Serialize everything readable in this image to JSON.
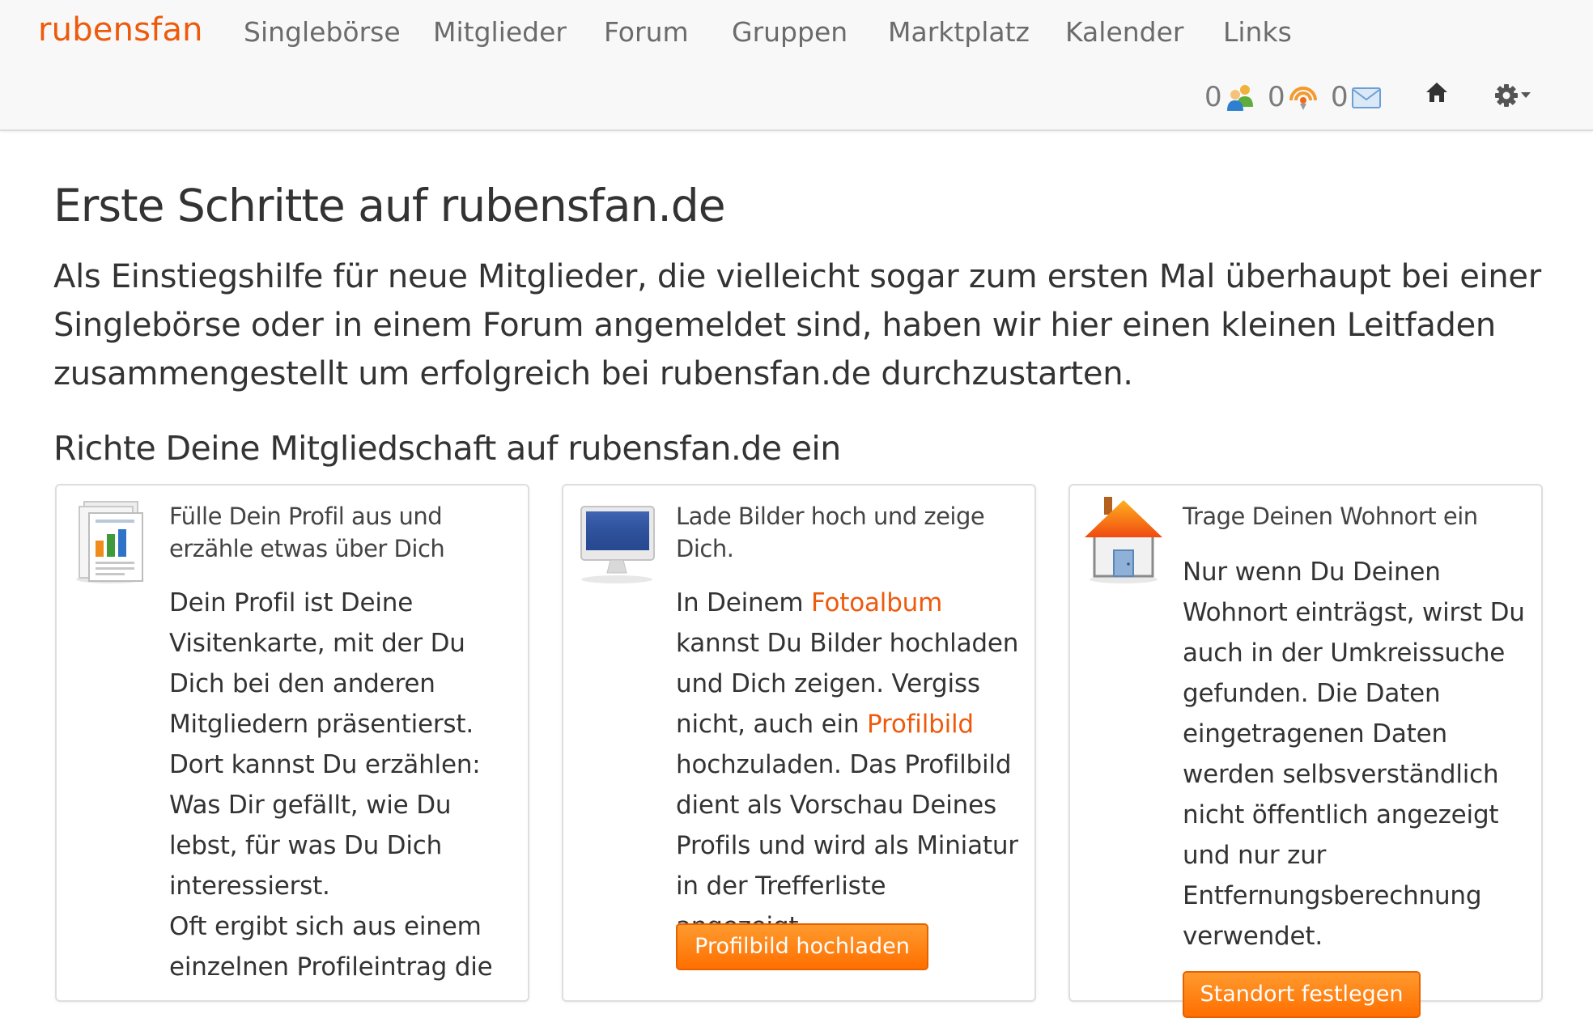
{
  "navbar": {
    "brand": "rubensfan",
    "items": [
      {
        "label": "Singlebörse"
      },
      {
        "label": "Mitglieder"
      },
      {
        "label": "Forum"
      },
      {
        "label": "Gruppen"
      },
      {
        "label": "Marktplatz"
      },
      {
        "label": "Kalender"
      },
      {
        "label": "Links"
      }
    ],
    "counters": {
      "friends": "0",
      "notifications": "0",
      "messages": "0"
    }
  },
  "main": {
    "title": "Erste Schritte auf rubensfan.de",
    "lead": "Als Einstiegshilfe für neue Mitglieder, die vielleicht sogar zum ersten Mal überhaupt bei einer Singlebörse oder in einem Forum angemeldet sind, haben wir hier einen kleinen Leitfaden zusammengestellt um erfolgreich bei rubensfan.de durchzustarten.",
    "section_title": "Richte Deine Mitgliedschaft auf rubensfan.de ein",
    "cards": [
      {
        "title": "Fülle Dein Profil aus und erzähle etwas über Dich",
        "text": "Dein Profil ist Deine Visitenkarte, mit der Du Dich bei den anderen Mitgliedern präsentierst. Dort kannst Du erzählen: Was Dir gefällt, wie Du lebst, für was Du Dich interessierst.",
        "text2": "Oft ergibt sich aus einem einzelnen Profileintrag die"
      },
      {
        "title": "Lade Bilder hoch und zeige Dich.",
        "text_a": "In Deinem ",
        "link1": "Fotoalbum",
        "text_b": " kannst Du Bilder hochladen und Dich zeigen. Vergiss nicht, auch ein ",
        "link2": "Profilbild",
        "text_c": " hochzuladen. Das Profilbild dient als Vorschau Deines Profils und wird als Miniatur in der Trefferliste angezeigt.",
        "button": "Profilbild hochladen"
      },
      {
        "title": "Trage Deinen Wohnort ein",
        "text": "Nur wenn Du Deinen Wohnort einträgst, wirst Du auch in der Umkreissuche gefunden. Die Daten eingetragenen Daten werden selbsverständlich nicht öffentlich angezeigt und nur zur Entfernungsberechnung verwendet.",
        "button": "Standort festlegen"
      }
    ]
  },
  "colors": {
    "accent": "#ee5a0c",
    "button": "#ff7b0f",
    "navbar_bg": "#f8f8f8"
  }
}
